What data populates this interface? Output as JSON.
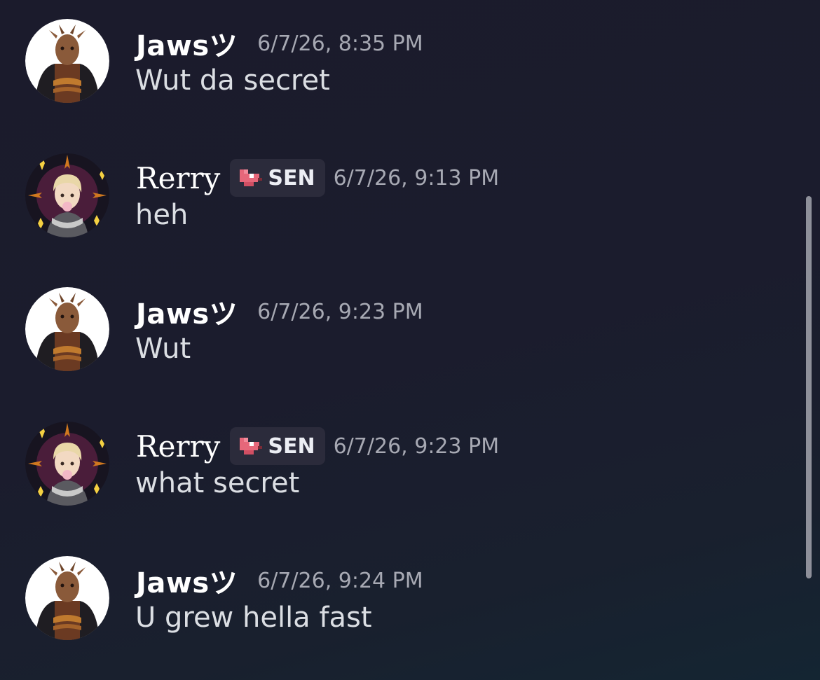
{
  "chat": {
    "messages": [
      {
        "author": "Jawsツ",
        "author_kind": "jaws",
        "role_tag": "",
        "timestamp": "6/7/26, 8:35 PM",
        "text": "Wut da secret"
      },
      {
        "author": "Rerry",
        "author_kind": "rerry",
        "role_tag": "SEN",
        "timestamp": "6/7/26, 9:13 PM",
        "text": "heh"
      },
      {
        "author": "Jawsツ",
        "author_kind": "jaws",
        "role_tag": "",
        "timestamp": "6/7/26, 9:23 PM",
        "text": "Wut"
      },
      {
        "author": "Rerry",
        "author_kind": "rerry",
        "role_tag": "SEN",
        "timestamp": "6/7/26, 9:23 PM",
        "text": "what secret"
      },
      {
        "author": "Jawsツ",
        "author_kind": "jaws",
        "role_tag": "",
        "timestamp": "6/7/26, 9:24 PM",
        "text": "U grew hella fast"
      }
    ]
  },
  "icons": {
    "avatar_jaws": "character-portrait-avatar",
    "avatar_rerry": "anime-character-avatar",
    "role_tag_icon": "pixel-fox-icon"
  },
  "colors": {
    "background": "#1b1b2c",
    "username": "#ffffff",
    "message_text": "#dbdee3",
    "timestamp": "#a7a9b3",
    "role_tag_bg": "#2b2b3b",
    "role_tag_icon": "#e6677a",
    "scrollbar": "#8e909a"
  }
}
